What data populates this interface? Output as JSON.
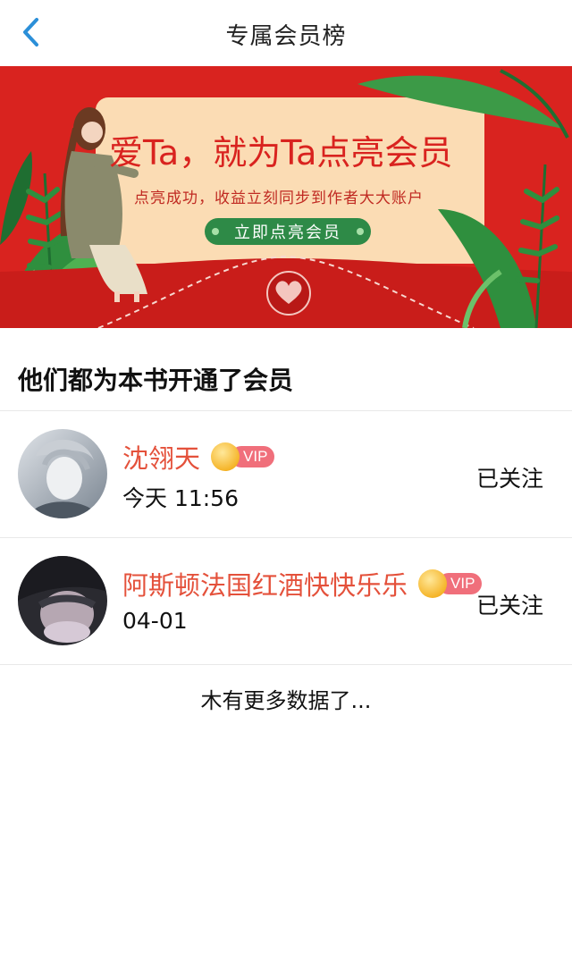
{
  "header": {
    "title": "专属会员榜",
    "back_icon": "chevron-left-icon",
    "accent_color": "#2b8fd8"
  },
  "banner": {
    "headline": "爱Ta，就为Ta点亮会员",
    "subline": "点亮成功，收益立刻同步到作者大大账户",
    "cta_label": "立即点亮会员",
    "bg_color": "#d9231f",
    "card_color": "#fbdcb4",
    "cta_color": "#2e8a47"
  },
  "section": {
    "title": "他们都为本书开通了会员"
  },
  "members": [
    {
      "name": "沈翎天",
      "time": "今天 11:56",
      "badge": "VIP",
      "follow_label": "已关注"
    },
    {
      "name": "阿斯顿法国红酒快快乐乐",
      "time": "04-01",
      "badge": "VIP",
      "follow_label": "已关注"
    }
  ],
  "footer": {
    "no_more_text": "木有更多数据了..."
  }
}
